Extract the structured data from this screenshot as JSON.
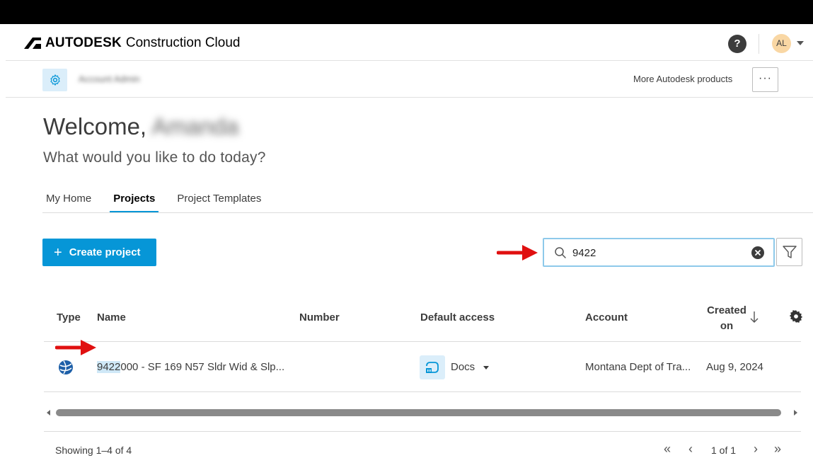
{
  "header": {
    "brand_name": "AUTODESK",
    "brand_sub": "Construction Cloud",
    "help_label": "?",
    "avatar_initials": "AL"
  },
  "subheader": {
    "account_label": "Account Admin",
    "more_products": "More Autodesk products",
    "more_button": "···"
  },
  "welcome": {
    "greeting": "Welcome,",
    "name": "Amanda",
    "prompt": "What would you like to do today?"
  },
  "tabs": [
    {
      "label": "My Home",
      "active": false
    },
    {
      "label": "Projects",
      "active": true
    },
    {
      "label": "Project Templates",
      "active": false
    }
  ],
  "toolbar": {
    "create_plus": "+",
    "create_label": "Create project",
    "search_value": "9422"
  },
  "table": {
    "columns": {
      "type": "Type",
      "name": "Name",
      "number": "Number",
      "default_access": "Default access",
      "account": "Account",
      "created_line1": "Created",
      "created_line2": "on"
    },
    "rows": [
      {
        "name_highlight": "9422",
        "name_rest": "000 - SF 169 N57 Sldr Wid & Slp...",
        "number": "",
        "access": "Docs",
        "account": "Montana Dept of Tra...",
        "created": "Aug 9, 2024"
      }
    ]
  },
  "footer": {
    "showing": "Showing 1–4 of 4",
    "first": "«",
    "prev": "‹",
    "page_of": "1 of 1",
    "next": "›",
    "last": "»"
  },
  "colors": {
    "accent": "#0696d7",
    "annotation_arrow": "#e01010"
  }
}
